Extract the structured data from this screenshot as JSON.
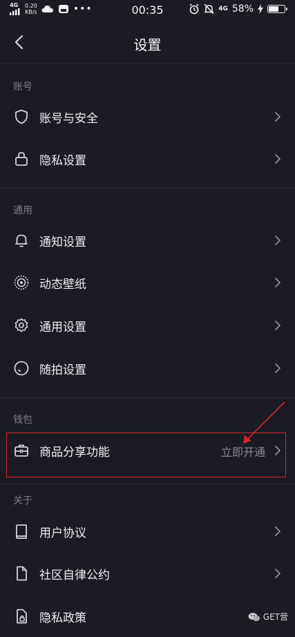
{
  "status_bar": {
    "network": "4G",
    "speed_value": "0.20",
    "speed_unit": "KB/s",
    "time": "00:35",
    "network2": "4G",
    "battery": "58%",
    "battery_level": 0.58
  },
  "nav": {
    "title": "设置"
  },
  "sections": {
    "account": {
      "title": "账号",
      "items": [
        {
          "label": "账号与安全",
          "icon": "shield-icon"
        },
        {
          "label": "隐私设置",
          "icon": "lock-icon"
        }
      ]
    },
    "general": {
      "title": "通用",
      "items": [
        {
          "label": "通知设置",
          "icon": "bell-icon"
        },
        {
          "label": "动态壁纸",
          "icon": "wallpaper-icon"
        },
        {
          "label": "通用设置",
          "icon": "gear-icon"
        },
        {
          "label": "随拍设置",
          "icon": "camera-circle-icon"
        }
      ]
    },
    "wallet": {
      "title": "钱包",
      "items": [
        {
          "label": "商品分享功能",
          "value": "立即开通",
          "icon": "briefcase-icon"
        }
      ]
    },
    "about": {
      "title": "关于",
      "items": [
        {
          "label": "用户协议",
          "icon": "book-icon"
        },
        {
          "label": "社区自律公约",
          "icon": "document-icon"
        },
        {
          "label": "隐私政策",
          "icon": "privacy-document-icon"
        }
      ]
    }
  },
  "watermark": {
    "text": "GET营"
  },
  "colors": {
    "background": "#1b1c23",
    "highlight": "#d8242b"
  }
}
